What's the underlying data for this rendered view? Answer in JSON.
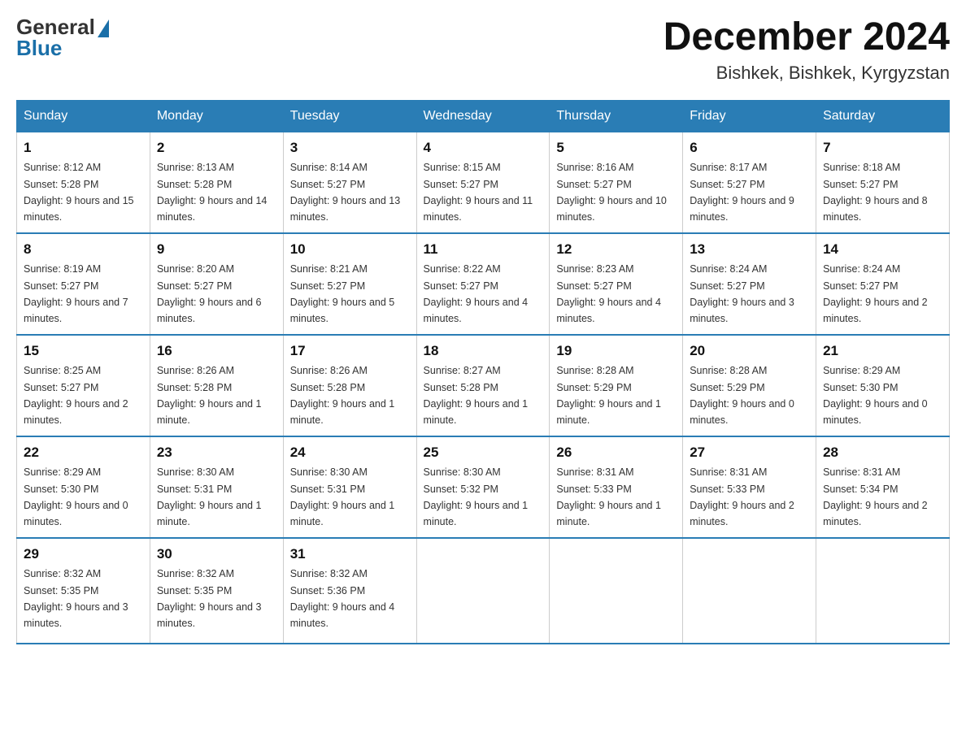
{
  "header": {
    "logo_general": "General",
    "logo_blue": "Blue",
    "title": "December 2024",
    "subtitle": "Bishkek, Bishkek, Kyrgyzstan"
  },
  "days_of_week": [
    "Sunday",
    "Monday",
    "Tuesday",
    "Wednesday",
    "Thursday",
    "Friday",
    "Saturday"
  ],
  "weeks": [
    [
      {
        "day": "1",
        "sunrise": "8:12 AM",
        "sunset": "5:28 PM",
        "daylight": "9 hours and 15 minutes."
      },
      {
        "day": "2",
        "sunrise": "8:13 AM",
        "sunset": "5:28 PM",
        "daylight": "9 hours and 14 minutes."
      },
      {
        "day": "3",
        "sunrise": "8:14 AM",
        "sunset": "5:27 PM",
        "daylight": "9 hours and 13 minutes."
      },
      {
        "day": "4",
        "sunrise": "8:15 AM",
        "sunset": "5:27 PM",
        "daylight": "9 hours and 11 minutes."
      },
      {
        "day": "5",
        "sunrise": "8:16 AM",
        "sunset": "5:27 PM",
        "daylight": "9 hours and 10 minutes."
      },
      {
        "day": "6",
        "sunrise": "8:17 AM",
        "sunset": "5:27 PM",
        "daylight": "9 hours and 9 minutes."
      },
      {
        "day": "7",
        "sunrise": "8:18 AM",
        "sunset": "5:27 PM",
        "daylight": "9 hours and 8 minutes."
      }
    ],
    [
      {
        "day": "8",
        "sunrise": "8:19 AM",
        "sunset": "5:27 PM",
        "daylight": "9 hours and 7 minutes."
      },
      {
        "day": "9",
        "sunrise": "8:20 AM",
        "sunset": "5:27 PM",
        "daylight": "9 hours and 6 minutes."
      },
      {
        "day": "10",
        "sunrise": "8:21 AM",
        "sunset": "5:27 PM",
        "daylight": "9 hours and 5 minutes."
      },
      {
        "day": "11",
        "sunrise": "8:22 AM",
        "sunset": "5:27 PM",
        "daylight": "9 hours and 4 minutes."
      },
      {
        "day": "12",
        "sunrise": "8:23 AM",
        "sunset": "5:27 PM",
        "daylight": "9 hours and 4 minutes."
      },
      {
        "day": "13",
        "sunrise": "8:24 AM",
        "sunset": "5:27 PM",
        "daylight": "9 hours and 3 minutes."
      },
      {
        "day": "14",
        "sunrise": "8:24 AM",
        "sunset": "5:27 PM",
        "daylight": "9 hours and 2 minutes."
      }
    ],
    [
      {
        "day": "15",
        "sunrise": "8:25 AM",
        "sunset": "5:27 PM",
        "daylight": "9 hours and 2 minutes."
      },
      {
        "day": "16",
        "sunrise": "8:26 AM",
        "sunset": "5:28 PM",
        "daylight": "9 hours and 1 minute."
      },
      {
        "day": "17",
        "sunrise": "8:26 AM",
        "sunset": "5:28 PM",
        "daylight": "9 hours and 1 minute."
      },
      {
        "day": "18",
        "sunrise": "8:27 AM",
        "sunset": "5:28 PM",
        "daylight": "9 hours and 1 minute."
      },
      {
        "day": "19",
        "sunrise": "8:28 AM",
        "sunset": "5:29 PM",
        "daylight": "9 hours and 1 minute."
      },
      {
        "day": "20",
        "sunrise": "8:28 AM",
        "sunset": "5:29 PM",
        "daylight": "9 hours and 0 minutes."
      },
      {
        "day": "21",
        "sunrise": "8:29 AM",
        "sunset": "5:30 PM",
        "daylight": "9 hours and 0 minutes."
      }
    ],
    [
      {
        "day": "22",
        "sunrise": "8:29 AM",
        "sunset": "5:30 PM",
        "daylight": "9 hours and 0 minutes."
      },
      {
        "day": "23",
        "sunrise": "8:30 AM",
        "sunset": "5:31 PM",
        "daylight": "9 hours and 1 minute."
      },
      {
        "day": "24",
        "sunrise": "8:30 AM",
        "sunset": "5:31 PM",
        "daylight": "9 hours and 1 minute."
      },
      {
        "day": "25",
        "sunrise": "8:30 AM",
        "sunset": "5:32 PM",
        "daylight": "9 hours and 1 minute."
      },
      {
        "day": "26",
        "sunrise": "8:31 AM",
        "sunset": "5:33 PM",
        "daylight": "9 hours and 1 minute."
      },
      {
        "day": "27",
        "sunrise": "8:31 AM",
        "sunset": "5:33 PM",
        "daylight": "9 hours and 2 minutes."
      },
      {
        "day": "28",
        "sunrise": "8:31 AM",
        "sunset": "5:34 PM",
        "daylight": "9 hours and 2 minutes."
      }
    ],
    [
      {
        "day": "29",
        "sunrise": "8:32 AM",
        "sunset": "5:35 PM",
        "daylight": "9 hours and 3 minutes."
      },
      {
        "day": "30",
        "sunrise": "8:32 AM",
        "sunset": "5:35 PM",
        "daylight": "9 hours and 3 minutes."
      },
      {
        "day": "31",
        "sunrise": "8:32 AM",
        "sunset": "5:36 PM",
        "daylight": "9 hours and 4 minutes."
      },
      null,
      null,
      null,
      null
    ]
  ]
}
